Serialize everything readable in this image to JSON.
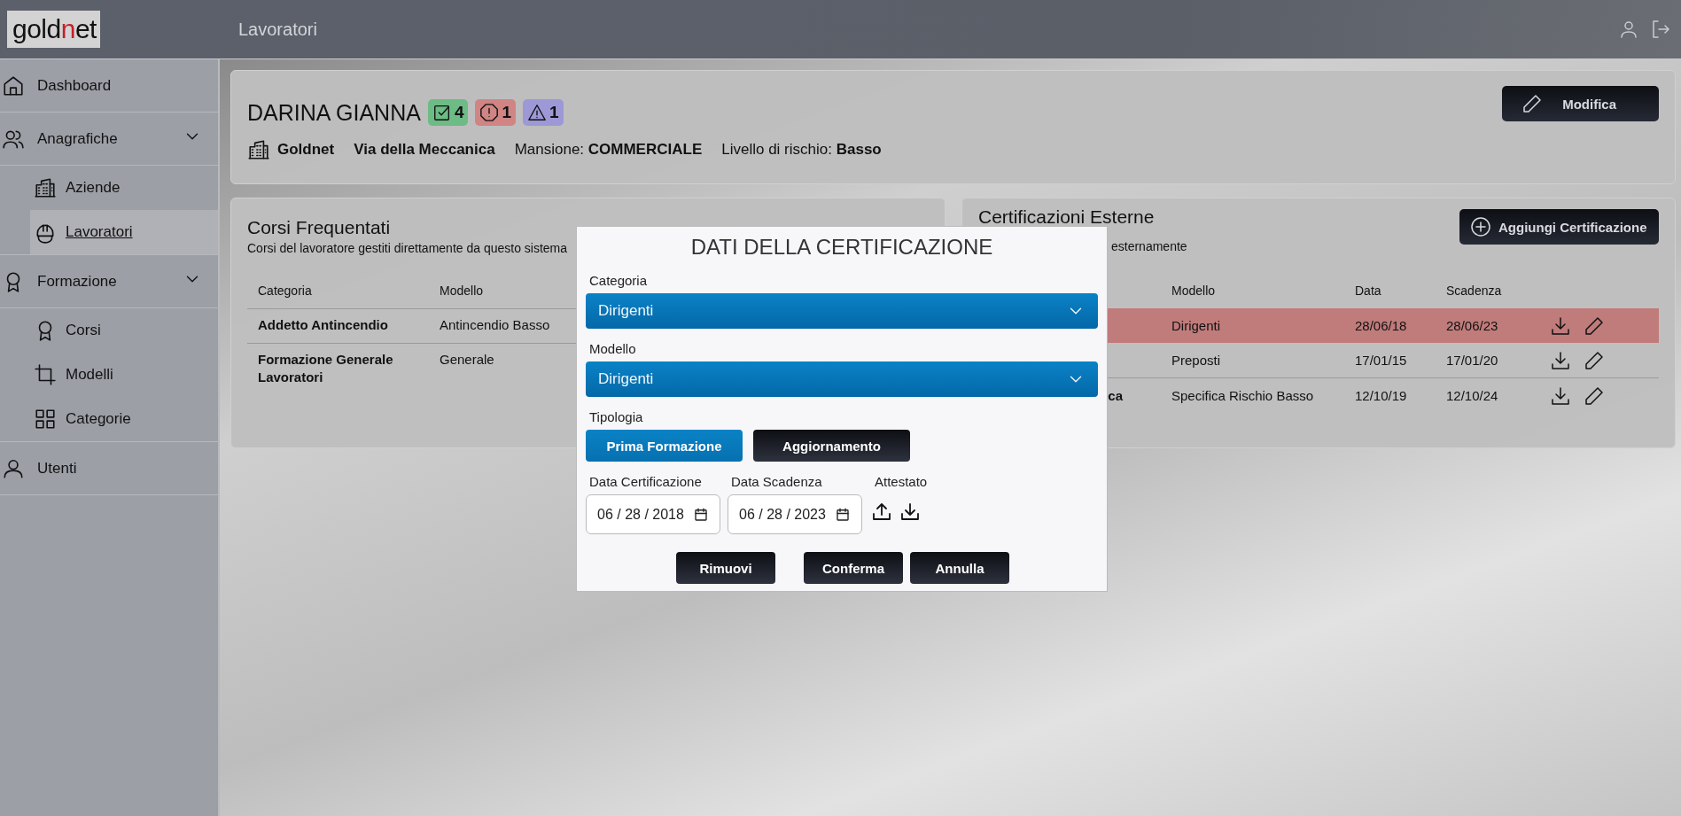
{
  "header": {
    "logo": {
      "before": "gold",
      "accent": "n",
      "after": "et"
    },
    "title": "Lavoratori"
  },
  "sidebar": {
    "items": [
      {
        "label": "Dashboard",
        "selected": false
      },
      {
        "label": "Anagrafiche",
        "selected": false,
        "expanded": true,
        "children": [
          {
            "label": "Aziende",
            "selected": false
          },
          {
            "label": "Lavoratori",
            "selected": true
          }
        ]
      },
      {
        "label": "Formazione",
        "selected": false,
        "expanded": true,
        "children": [
          {
            "label": "Corsi",
            "selected": false
          },
          {
            "label": "Modelli",
            "selected": false
          },
          {
            "label": "Categorie",
            "selected": false
          }
        ]
      },
      {
        "label": "Utenti",
        "selected": false
      }
    ]
  },
  "worker": {
    "name": "DARINA GIANNA",
    "badges": [
      {
        "kind": "completed",
        "count": "4",
        "color": "#6dbb85"
      },
      {
        "kind": "expired",
        "count": "1",
        "color": "#d08484"
      },
      {
        "kind": "warning",
        "count": "1",
        "color": "#9d98d6"
      }
    ],
    "company": "Goldnet",
    "address": "Via della Meccanica",
    "role": "Mansione: **COMMERCIALE**",
    "risk": "Livello di rischio: **Basso**",
    "edit_button": "Modifica"
  },
  "courses": {
    "title": "Corsi Frequentati",
    "subtitle": "Corsi del lavoratore gestiti direttamente da questo sistema",
    "columns": [
      "Categoria",
      "Modello"
    ],
    "rows": [
      {
        "categoria": "Addetto Antincendio",
        "modello": "Antincendio Basso"
      },
      {
        "categoria": "Formazione Generale Lavoratori",
        "modello": "Generale"
      }
    ]
  },
  "certifications": {
    "title": "Certificazioni Esterne",
    "subtitle": "esternamente",
    "add_button": "Aggiungi Certificazione",
    "columns": [
      "Modello",
      "Data",
      "Scadenza"
    ],
    "rows": [
      {
        "modello": "Dirigenti",
        "data": "28/06/18",
        "scadenza": "28/06/23",
        "expired": true
      },
      {
        "modello": "Preposti",
        "data": "17/01/15",
        "scadenza": "17/01/20",
        "expired": false
      },
      {
        "categoria": "ca",
        "modello": "Specifica Rischio Basso",
        "data": "12/10/19",
        "scadenza": "12/10/24",
        "expired": false
      }
    ]
  },
  "modal": {
    "title": "DATI DELLA CERTIFICAZIONE",
    "selects": [
      {
        "label": "Categoria",
        "value": "Dirigenti"
      },
      {
        "label": "Modello",
        "value": "Dirigenti"
      }
    ],
    "tipologia": {
      "label": "Tipologia",
      "options": [
        {
          "label": "Prima Formazione",
          "selected": true
        },
        {
          "label": "Aggiornamento",
          "selected": false
        }
      ]
    },
    "dates": [
      {
        "label": "Data Certificazione",
        "value": "06 / 28 / 2018"
      },
      {
        "label": "Data Scadenza",
        "value": "06 / 28 / 2023"
      }
    ],
    "attestato": {
      "label": "Attestato"
    },
    "buttons": [
      "Rimuovi",
      "Conferma",
      "Annulla"
    ]
  }
}
